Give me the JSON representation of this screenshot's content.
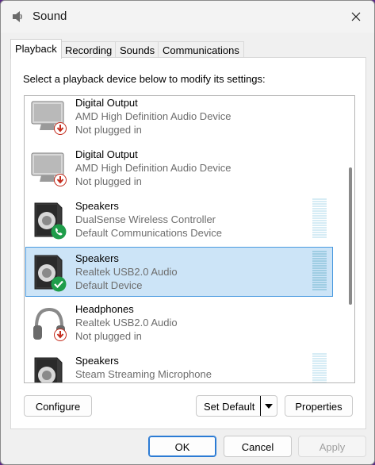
{
  "window": {
    "title": "Sound"
  },
  "tabs": [
    {
      "label": "Playback",
      "active": true
    },
    {
      "label": "Recording",
      "active": false
    },
    {
      "label": "Sounds",
      "active": false
    },
    {
      "label": "Communications",
      "active": false
    }
  ],
  "instruction": "Select a playback device below to modify its settings:",
  "devices": [
    {
      "name": "Digital Output",
      "description": "AMD High Definition Audio Device",
      "status": "Not plugged in",
      "icon": "monitor-icon",
      "badge": "unplugged-arrow-icon"
    },
    {
      "name": "Digital Output",
      "description": "AMD High Definition Audio Device",
      "status": "Not plugged in",
      "icon": "monitor-icon",
      "badge": "unplugged-arrow-icon"
    },
    {
      "name": "Speakers",
      "description": "DualSense Wireless Controller",
      "status": "Default Communications Device",
      "icon": "speaker-icon",
      "badge": "phone-badge-icon"
    },
    {
      "name": "Speakers",
      "description": "Realtek USB2.0 Audio",
      "status": "Default Device",
      "icon": "speaker-icon",
      "badge": "checkmark-badge-icon",
      "selected": true
    },
    {
      "name": "Headphones",
      "description": "Realtek USB2.0 Audio",
      "status": "Not plugged in",
      "icon": "headphones-icon",
      "badge": "unplugged-arrow-icon"
    },
    {
      "name": "Speakers",
      "description": "Steam Streaming Microphone",
      "status": "",
      "icon": "speaker-icon",
      "badge": ""
    }
  ],
  "buttons": {
    "configure": "Configure",
    "set_default": "Set Default",
    "properties": "Properties",
    "ok": "OK",
    "cancel": "Cancel",
    "apply": "Apply"
  }
}
